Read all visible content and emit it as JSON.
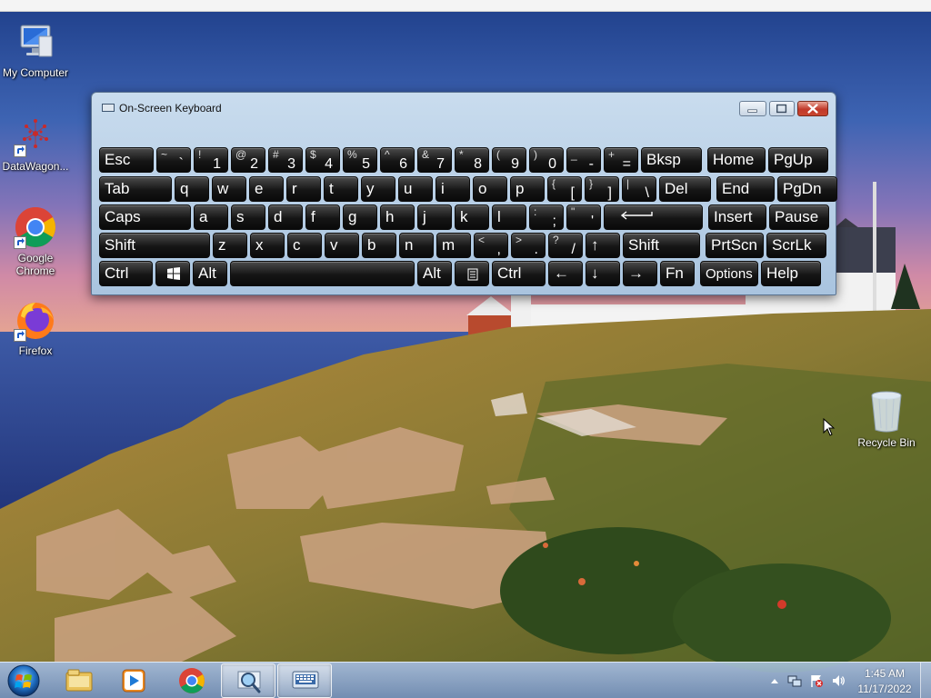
{
  "desktop": {
    "icons": [
      {
        "label": "My Computer",
        "icon": "computer-icon"
      },
      {
        "label": "DataWagon...",
        "icon": "datawagon-app-icon"
      },
      {
        "label": "Google Chrome",
        "icon": "chrome-icon"
      },
      {
        "label": "Firefox",
        "icon": "firefox-icon"
      },
      {
        "label": "Recycle Bin",
        "icon": "recycle-bin-icon"
      }
    ]
  },
  "osk": {
    "title": "On-Screen Keyboard",
    "rows": [
      [
        {
          "main": "Esc"
        },
        {
          "shift": "~",
          "main": "`"
        },
        {
          "shift": "!",
          "main": "1"
        },
        {
          "shift": "@",
          "main": "2"
        },
        {
          "shift": "#",
          "main": "3"
        },
        {
          "shift": "$",
          "main": "4"
        },
        {
          "shift": "%",
          "main": "5"
        },
        {
          "shift": "^",
          "main": "6"
        },
        {
          "shift": "&",
          "main": "7"
        },
        {
          "shift": "*",
          "main": "8"
        },
        {
          "shift": "(",
          "main": "9"
        },
        {
          "shift": ")",
          "main": "0"
        },
        {
          "shift": "_",
          "main": "-"
        },
        {
          "shift": "+",
          "main": "="
        },
        {
          "main": "Bksp"
        },
        {
          "main": "Home"
        },
        {
          "main": "PgUp"
        }
      ],
      [
        {
          "main": "Tab"
        },
        {
          "main": "q"
        },
        {
          "main": "w"
        },
        {
          "main": "e"
        },
        {
          "main": "r"
        },
        {
          "main": "t"
        },
        {
          "main": "y"
        },
        {
          "main": "u"
        },
        {
          "main": "i"
        },
        {
          "main": "o"
        },
        {
          "main": "p"
        },
        {
          "shift": "{",
          "main": "["
        },
        {
          "shift": "}",
          "main": "]"
        },
        {
          "shift": "|",
          "main": "\\"
        },
        {
          "main": "Del"
        },
        {
          "main": "End"
        },
        {
          "main": "PgDn"
        }
      ],
      [
        {
          "main": "Caps"
        },
        {
          "main": "a"
        },
        {
          "main": "s"
        },
        {
          "main": "d"
        },
        {
          "main": "f"
        },
        {
          "main": "g"
        },
        {
          "main": "h"
        },
        {
          "main": "j"
        },
        {
          "main": "k"
        },
        {
          "main": "l"
        },
        {
          "shift": ":",
          "main": ";"
        },
        {
          "shift": "\"",
          "main": "'"
        },
        {
          "main": "",
          "icon": "enter-arrow-icon"
        },
        {
          "main": "Insert"
        },
        {
          "main": "Pause"
        }
      ],
      [
        {
          "main": "Shift"
        },
        {
          "main": "z"
        },
        {
          "main": "x"
        },
        {
          "main": "c"
        },
        {
          "main": "v"
        },
        {
          "main": "b"
        },
        {
          "main": "n"
        },
        {
          "main": "m"
        },
        {
          "shift": "<",
          "main": ","
        },
        {
          "shift": ">",
          "main": "."
        },
        {
          "shift": "?",
          "main": "/"
        },
        {
          "main": "↑"
        },
        {
          "main": "Shift"
        },
        {
          "main": "PrtScn"
        },
        {
          "main": "ScrLk"
        }
      ],
      [
        {
          "main": "Ctrl"
        },
        {
          "main": "",
          "icon": "windows-logo-icon"
        },
        {
          "main": "Alt"
        },
        {
          "main": "",
          "icon": "spacebar"
        },
        {
          "main": "Alt"
        },
        {
          "main": "",
          "icon": "menu-key-icon"
        },
        {
          "main": "Ctrl"
        },
        {
          "main": "←"
        },
        {
          "main": "↓"
        },
        {
          "main": "→"
        },
        {
          "main": "Fn"
        },
        {
          "main": "Options"
        },
        {
          "main": "Help"
        }
      ]
    ]
  },
  "taskbar": {
    "pinned": [
      {
        "icon": "file-explorer-icon",
        "active": false
      },
      {
        "icon": "media-player-icon",
        "active": false
      },
      {
        "icon": "chrome-icon",
        "active": false
      },
      {
        "icon": "magnifier-icon",
        "active": true
      },
      {
        "icon": "keyboard-icon",
        "active": true
      }
    ],
    "tray_icons": [
      "show-hidden-icons-icon",
      "network-icon",
      "action-center-icon",
      "volume-icon"
    ],
    "clock_time": "1:45 AM",
    "clock_date": "11/17/2022"
  },
  "colors": {
    "key_face": "#1a1a1a",
    "window_frame": "#b7cde3",
    "close_button": "#c9462f"
  }
}
